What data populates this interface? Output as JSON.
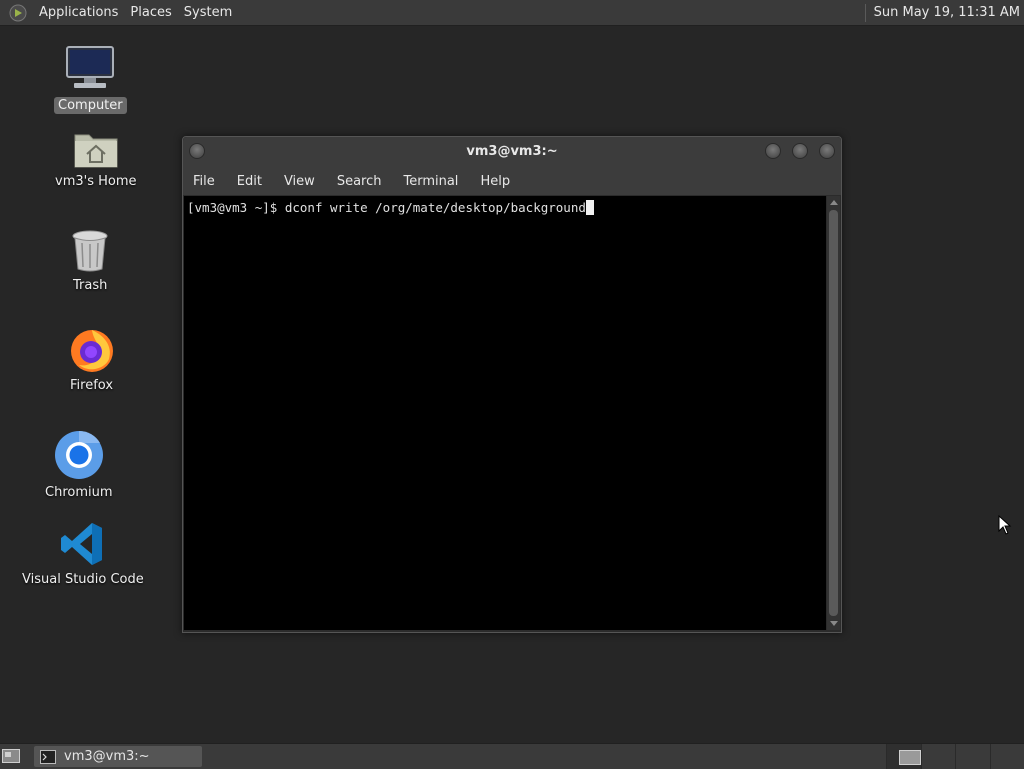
{
  "top_panel": {
    "menus": [
      "Applications",
      "Places",
      "System"
    ],
    "clock": "Sun May 19, 11:31 AM"
  },
  "desktop_icons": [
    {
      "label": "Computer",
      "icon": "computer-icon"
    },
    {
      "label": "vm3's Home",
      "icon": "home-folder-icon"
    },
    {
      "label": "Trash",
      "icon": "trash-icon"
    },
    {
      "label": "Firefox",
      "icon": "firefox-icon"
    },
    {
      "label": "Chromium",
      "icon": "chromium-icon"
    },
    {
      "label": "Visual Studio Code",
      "icon": "vscode-icon"
    }
  ],
  "terminal": {
    "title": "vm3@vm3:~",
    "menu": [
      "File",
      "Edit",
      "View",
      "Search",
      "Terminal",
      "Help"
    ],
    "prompt": "[vm3@vm3 ~]$ ",
    "command": "dconf write /org/mate/desktop/background"
  },
  "bottom_panel": {
    "task_label": "vm3@vm3:~"
  },
  "colors": {
    "desktop_bg": "#262626",
    "panel_bg": "#3a3a3a",
    "terminal_bg": "#000000",
    "selected_label_bg": "#6a6a6a"
  }
}
